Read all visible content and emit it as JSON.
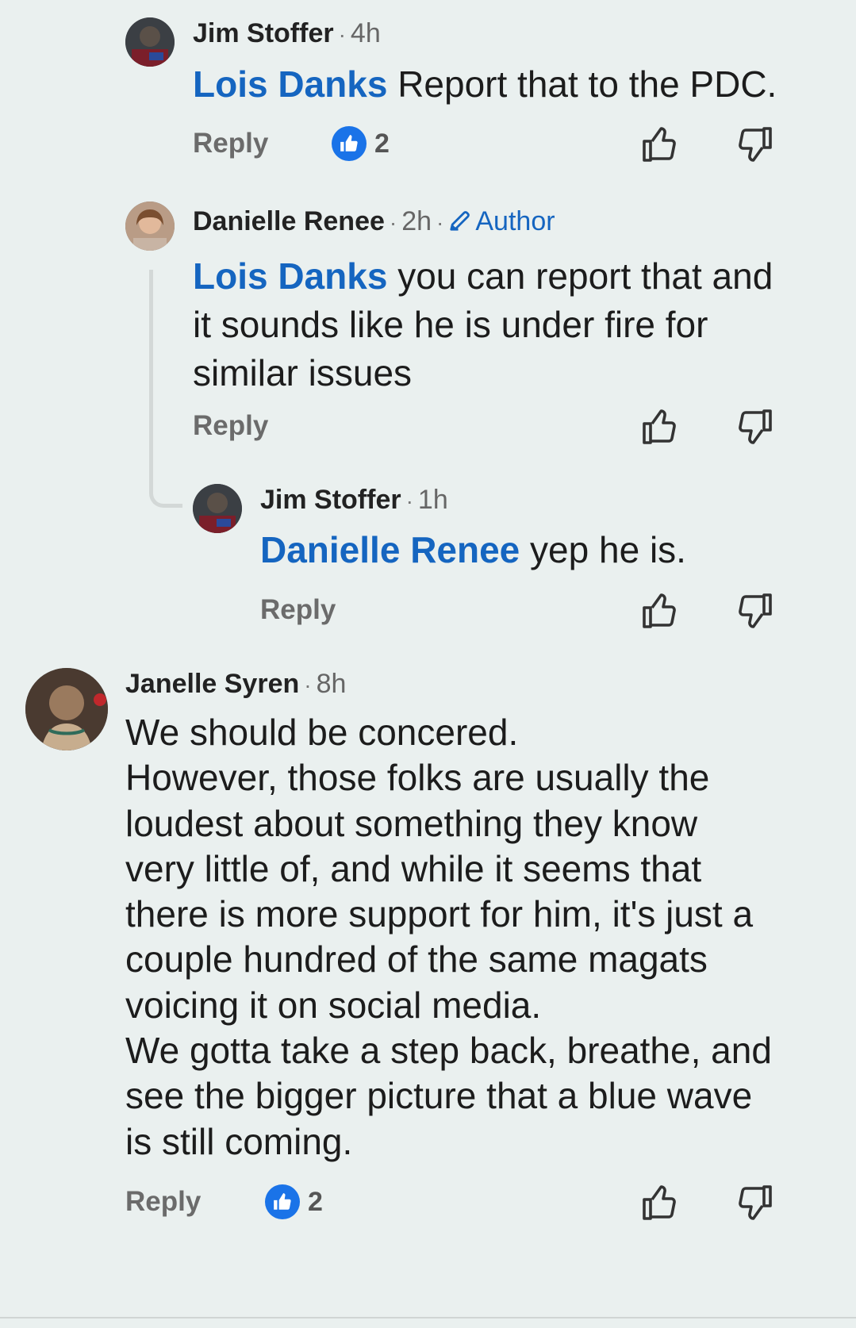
{
  "comments": [
    {
      "name": "Jim Stoffer",
      "time": "4h",
      "mention": "Lois Danks",
      "text": " Report that to the PDC.",
      "reply_label": "Reply",
      "likes": "2"
    },
    {
      "name": "Danielle Renee",
      "time": "2h",
      "badge": "Author",
      "mention": "Lois Danks",
      "text": " you can report that and it sounds like he is under fire for similar issues",
      "reply_label": "Reply"
    },
    {
      "name": "Jim Stoffer",
      "time": "1h",
      "mention": "Danielle Renee",
      "text": " yep he is.",
      "reply_label": "Reply"
    },
    {
      "name": "Janelle Syren",
      "time": "8h",
      "lines": [
        "We should be concered.",
        "However, those folks are usually the",
        "loudest about something they know",
        "very little of, and while it seems that",
        "there is more support for him, it's just a",
        "couple hundred of the same magats",
        "voicing it on social media.",
        "We gotta take a step back, breathe, and",
        "see the bigger picture that a blue wave",
        "is still coming."
      ],
      "reply_label": "Reply",
      "likes": "2"
    }
  ],
  "separator": "·",
  "colors": {
    "background": "#eaf0ef",
    "mention": "#1565c0",
    "like_badge": "#1a73e8"
  },
  "icons": {
    "like": "thumbs-up-icon",
    "dislike": "thumbs-down-icon",
    "author": "pencil-icon"
  }
}
